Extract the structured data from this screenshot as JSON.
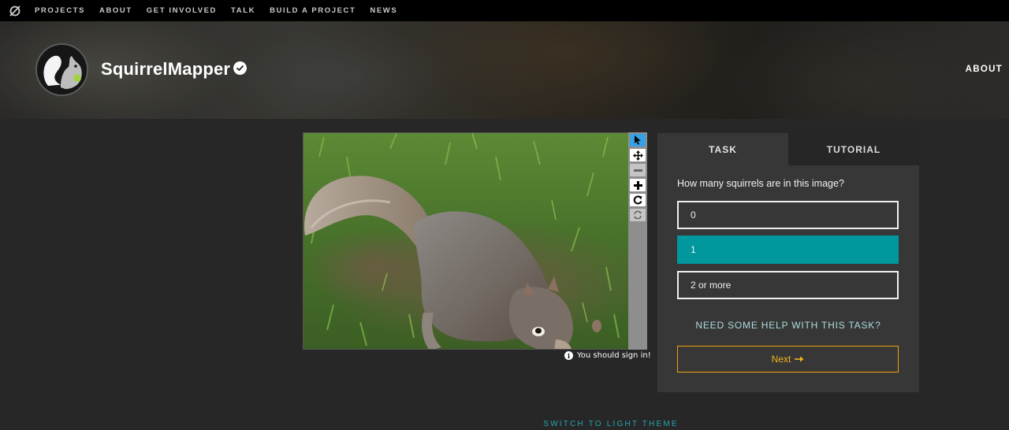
{
  "topnav": {
    "logo_icon": "zooniverse-logo-icon",
    "items": [
      "PROJECTS",
      "ABOUT",
      "GET INVOLVED",
      "TALK",
      "BUILD A PROJECT",
      "NEWS"
    ]
  },
  "hero": {
    "project_title": "SquirrelMapper",
    "verified_icon": "verified-badge-icon",
    "about_link": "ABOUT"
  },
  "viewer": {
    "image_subject": "grey squirrel foraging in grass",
    "tools": [
      "pointer-icon",
      "move-icon",
      "zoom-out-icon",
      "zoom-in-icon",
      "rotate-icon",
      "reset-icon"
    ],
    "signin_note": "You should sign in!"
  },
  "task": {
    "tabs": [
      "TASK",
      "TUTORIAL"
    ],
    "active_tab": "TASK",
    "question": "How many squirrels are in this image?",
    "answers": [
      "0",
      "1",
      "2 or more"
    ],
    "selected_answer": "1",
    "help_link": "NEED SOME HELP WITH THIS TASK?",
    "next_label": "Next",
    "next_icon": "arrow-right-icon"
  },
  "footer": {
    "theme_switch": "SWITCH TO LIGHT THEME"
  },
  "colors": {
    "selected_answer": "#00979d",
    "next_border": "#f0a30a",
    "help_link": "#addde0",
    "theme_switch": "#26a3ad",
    "active_tool": "#37a0e6"
  }
}
